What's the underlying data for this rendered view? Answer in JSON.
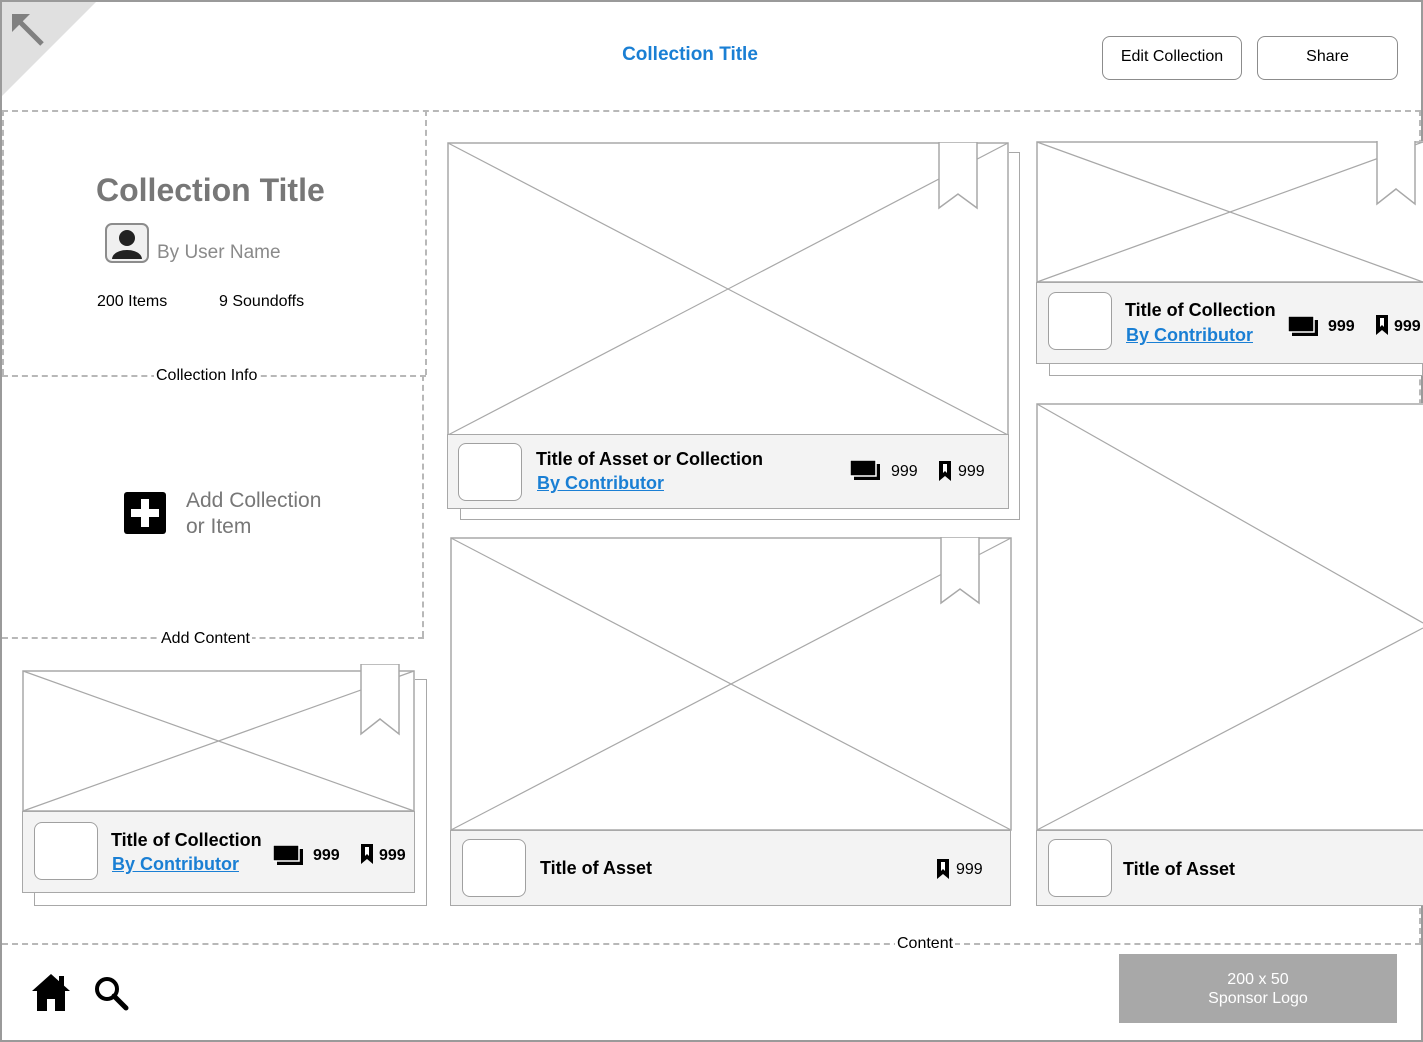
{
  "header": {
    "title": "Collection Title",
    "edit_label": "Edit Collection",
    "share_label": "Share"
  },
  "collection_info": {
    "title": "Collection Title",
    "by_user": "By User Name",
    "items": "200 Items",
    "soundoffs": "9 Soundoffs",
    "region_label": "Collection Info"
  },
  "add_content": {
    "line1": "Add Collection",
    "line2": "or Item",
    "region_label": "Add Content"
  },
  "content_label": "Content",
  "cards": {
    "asset_or_collection": {
      "title": "Title of Asset or Collection",
      "contributor": "By Contributor",
      "comments": "999",
      "bookmarks": "999"
    },
    "top_right_collection": {
      "title": "Title of Collection",
      "contributor": "By Contributor",
      "comments": "999",
      "bookmarks": "999"
    },
    "bottom_left_collection": {
      "title": "Title of Collection",
      "contributor": "By Contributor",
      "comments": "999",
      "bookmarks": "999"
    },
    "middle_asset": {
      "title": "Title of Asset",
      "bookmarks": "999"
    },
    "right_asset": {
      "title": "Title of Asset"
    }
  },
  "sponsor": {
    "line1": "200 x 50",
    "line2": "Sponsor Logo"
  },
  "colors": {
    "accent": "#1a7fd4",
    "sponsor_bg": "#a8a8a8",
    "footer_bg": "#f3f3f3"
  },
  "icons": [
    "back-arrow-icon",
    "avatar-icon",
    "plus-icon",
    "bookmark-icon",
    "comment-icon",
    "home-icon",
    "search-icon"
  ]
}
